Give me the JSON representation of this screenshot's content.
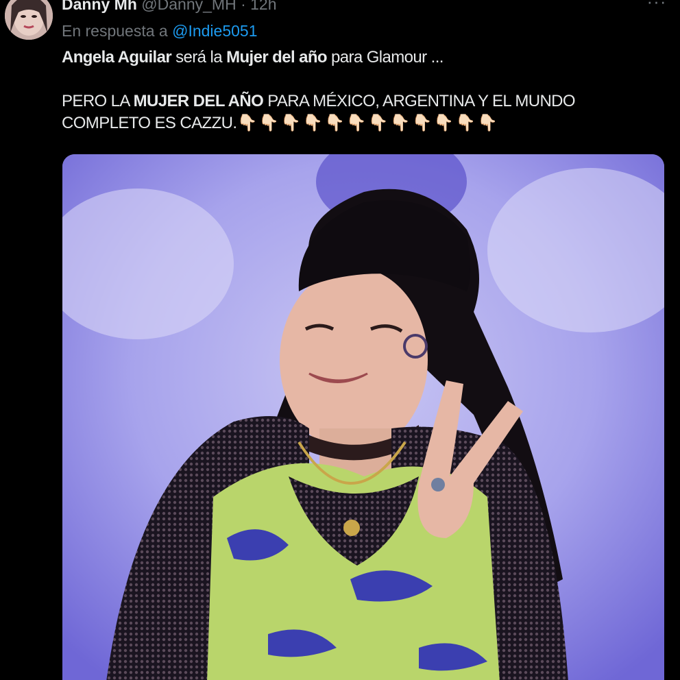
{
  "tweet": {
    "display_name": "Danny Mh",
    "handle": "@Danny_MH",
    "separator": "·",
    "time": "12h",
    "more_label": "···",
    "reply_prefix": "En respuesta a",
    "reply_to": "@Indie5051",
    "text_line1": {
      "part1": "Angela Aguilar",
      "part2": " será la ",
      "part3": "Mujer del año",
      "part4": " para Glamour ..."
    },
    "text_line2": {
      "part1": "PERO LA ",
      "part2": "MUJER DEL AÑO",
      "part3": " PARA MÉXICO, ARGENTINA Y EL MUNDO"
    },
    "text_line3": {
      "part1": "COMPLETO ES CAZZU.",
      "emojis": "👇🏻👇🏻👇🏻👇🏻👇🏻👇🏻👇🏻👇🏻👇🏻👇🏻👇🏻👇🏻"
    }
  },
  "icons": {
    "avatar": "user-avatar",
    "more": "more-horizontal-icon"
  },
  "colors": {
    "background": "#000000",
    "text": "#e7e9ea",
    "muted": "#71767b",
    "link": "#1d9bf0"
  }
}
